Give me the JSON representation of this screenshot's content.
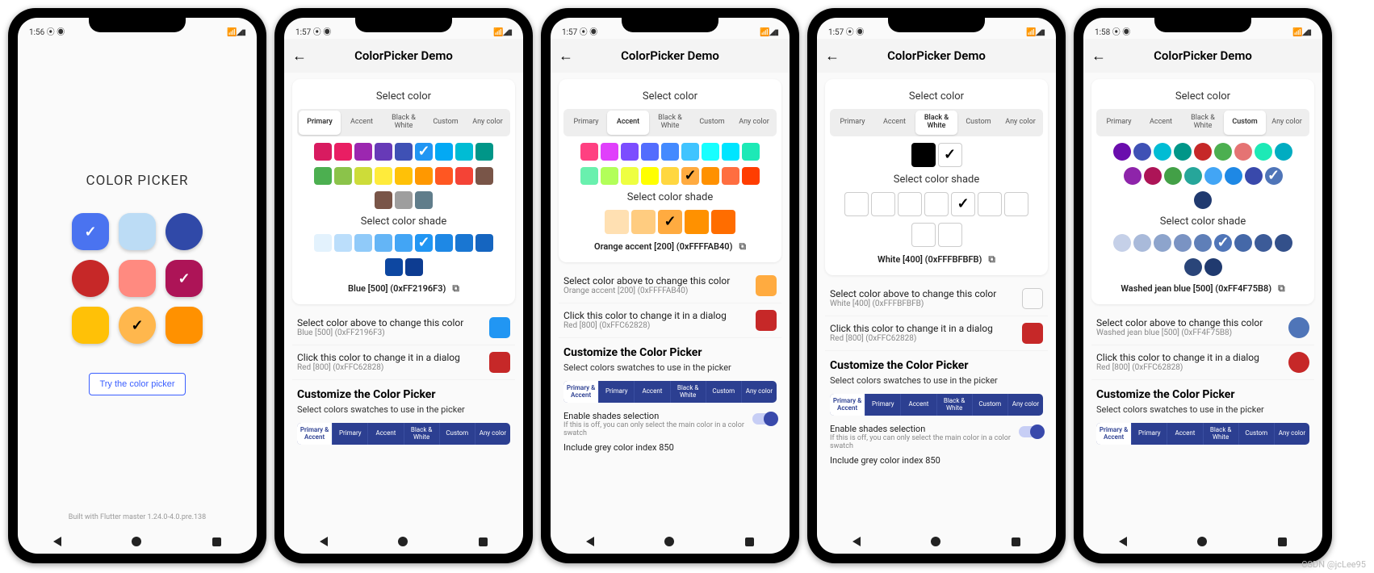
{
  "phones": [
    {
      "time": "1:56",
      "home": {
        "title": "COLOR PICKER",
        "swatches": [
          {
            "color": "#4a73f0",
            "shape": "sq",
            "check": "white"
          },
          {
            "color": "#bcdcf5",
            "shape": "sq"
          },
          {
            "color": "#3049a8",
            "shape": "circle"
          },
          {
            "color": "#c62828",
            "shape": "circle"
          },
          {
            "color": "#ff8a80",
            "shape": "sq"
          },
          {
            "color": "#ad1457",
            "shape": "sq",
            "check": "white"
          },
          {
            "color": "#ffc107",
            "shape": "sq"
          },
          {
            "color": "#ffb74d",
            "shape": "circle",
            "check": "dark"
          },
          {
            "color": "#ff9100",
            "shape": "sq"
          }
        ],
        "button": "Try the color picker",
        "footer": "Built with Flutter master 1.24.0-4.0.pre.138"
      }
    },
    {
      "time": "1:57",
      "appbar_title": "ColorPicker Demo",
      "select_color_title": "Select color",
      "tabs": [
        "Primary",
        "Accent",
        "Black & White",
        "Custom",
        "Any color"
      ],
      "active_tab": 0,
      "main_swatches": [
        [
          "#d81b60",
          "#e91e63",
          "#9c27b0",
          "#673ab7",
          "#3f51b5",
          "#2196f3",
          "#03a9f4",
          "#00bcd4",
          "#009688"
        ],
        [
          "#4caf50",
          "#8bc34a",
          "#cddc39",
          "#ffeb3b",
          "#ffc107",
          "#ff9800",
          "#ff5722",
          "#f44336",
          "#795548"
        ],
        [
          "#795548",
          "#9e9e9e",
          "#607d8b"
        ]
      ],
      "main_checked": {
        "row": 0,
        "col": 5,
        "tone": "white"
      },
      "shade_title": "Select color shade",
      "shade_swatches": [
        [
          "#e3f2fd",
          "#bbdefb",
          "#90caf9",
          "#64b5f6",
          "#42a5f5",
          "#2196f3",
          "#1e88e5",
          "#1976d2",
          "#1565c0"
        ],
        [
          "#0d47a1",
          "#0d3c91"
        ]
      ],
      "shade_checked": {
        "row": 0,
        "col": 5,
        "tone": "white"
      },
      "result": "Blue [500] (0xFF2196F3)",
      "row_above": {
        "t1": "Select color above to change this color",
        "t2": "Blue [500] (0xFF2196F3)",
        "color": "#2196f3"
      },
      "row_dialog": {
        "t1": "Click this color to change it in a dialog",
        "t2": "Red [800] (0xFFC62828)",
        "color": "#c62828"
      },
      "customize_h": "Customize the Color Picker",
      "customize_sub": "Select colors swatches to use in the picker",
      "seg": [
        "Primary & Accent",
        "Primary",
        "Accent",
        "Black & White",
        "Custom",
        "Any color"
      ],
      "seg_active": 0
    },
    {
      "time": "1:57",
      "appbar_title": "ColorPicker Demo",
      "select_color_title": "Select color",
      "tabs": [
        "Primary",
        "Accent",
        "Black & White",
        "Custom",
        "Any color"
      ],
      "active_tab": 1,
      "main_swatches": [
        [
          "#ff4081",
          "#e040fb",
          "#7c4dff",
          "#536dfe",
          "#448aff",
          "#40c4ff",
          "#18ffff",
          "#00e5ff",
          "#1de9b6"
        ],
        [
          "#69f0ae",
          "#b2ff59",
          "#eeff41",
          "#ffff00",
          "#ffd740",
          "#ffab40",
          "#ff9100",
          "#ff6e40",
          "#ff3d00"
        ]
      ],
      "main_checked": {
        "row": 1,
        "col": 5,
        "tone": "dark"
      },
      "shade_title": "Select color shade",
      "shade_swatches": [
        [
          "#ffe0b2",
          "#ffcc80",
          "#ffab40",
          "#ff9100",
          "#ff6d00"
        ]
      ],
      "shade_bigger": true,
      "shade_checked": {
        "row": 0,
        "col": 2,
        "tone": "dark"
      },
      "result": "Orange accent [200] (0xFFFFAB40)",
      "row_above": {
        "t1": "Select color above to change this color",
        "t2": "Orange accent [200] (0xFFFFAB40)",
        "color": "#ffab40"
      },
      "row_dialog": {
        "t1": "Click this color to change it in a dialog",
        "t2": "Red [800] (0xFFC62828)",
        "color": "#c62828"
      },
      "customize_h": "Customize the Color Picker",
      "customize_sub": "Select colors swatches to use in the picker",
      "seg": [
        "Primary & Accent",
        "Primary",
        "Accent",
        "Black & White",
        "Custom",
        "Any color"
      ],
      "seg_active": 0,
      "toggle1": {
        "t1": "Enable shades selection",
        "t2": "If this is off, you can only select the main color in a color swatch"
      },
      "extra_line": "Include grey color index 850"
    },
    {
      "time": "1:57",
      "appbar_title": "ColorPicker Demo",
      "select_color_title": "Select color",
      "tabs": [
        "Primary",
        "Accent",
        "Black & White",
        "Custom",
        "Any color"
      ],
      "active_tab": 2,
      "bw_swatches": [
        {
          "color": "#000000"
        },
        {
          "color": "#ffffff",
          "check": "dark",
          "border": true
        }
      ],
      "shade_title": "Select color shade",
      "bw_shades": [
        [
          {
            "c": "#ffffff"
          },
          {
            "c": "#ffffff"
          },
          {
            "c": "#ffffff"
          },
          {
            "c": "#ffffff"
          },
          {
            "c": "#ffffff",
            "check": "dark"
          },
          {
            "c": "#ffffff"
          },
          {
            "c": "#ffffff"
          }
        ],
        [
          {
            "c": "#ffffff"
          },
          {
            "c": "#ffffff"
          }
        ]
      ],
      "result": "White [400] (0xFFFBFBFB)",
      "row_above": {
        "t1": "Select color above to change this color",
        "t2": "White [400] (0xFFFBFBFB)",
        "color": "#fbfbfb",
        "border": true
      },
      "row_dialog": {
        "t1": "Click this color to change it in a dialog",
        "t2": "Red [800] (0xFFC62828)",
        "color": "#c62828"
      },
      "customize_h": "Customize the Color Picker",
      "customize_sub": "Select colors swatches to use in the picker",
      "seg": [
        "Primary & Accent",
        "Primary",
        "Accent",
        "Black & White",
        "Custom",
        "Any color"
      ],
      "seg_active": 0,
      "toggle1": {
        "t1": "Enable shades selection",
        "t2": "If this is off, you can only select the main color in a color swatch"
      },
      "extra_line": "Include grey color index 850"
    },
    {
      "time": "1:58",
      "appbar_title": "ColorPicker Demo",
      "select_color_title": "Select color",
      "tabs": [
        "Primary",
        "Accent",
        "Black & White",
        "Custom",
        "Any color"
      ],
      "active_tab": 3,
      "custom_swatches": [
        [
          "#6a0dad",
          "#3f51b5",
          "#00bcd4",
          "#009688",
          "#c62828",
          "#4caf50",
          "#e57373",
          "#1de9b6",
          "#00acc1"
        ],
        [
          "#8e24aa",
          "#ad1457",
          "#43a047",
          "#26a69a",
          "#42a5f5",
          "#1e88e5",
          "#3949ab",
          "#4f75b8"
        ],
        [
          "#203a6f"
        ]
      ],
      "custom_round": true,
      "main_checked": {
        "row": 1,
        "col": 7,
        "tone": "white"
      },
      "shade_title": "Select color shade",
      "custom_shades": [
        [
          "#c5d0e8",
          "#a9bada",
          "#8da4cc",
          "#7a93c3",
          "#5f7fb8",
          "#4f75b8",
          "#4568a8",
          "#3c5b98",
          "#33508a"
        ],
        [
          "#2a4579",
          "#203a6f"
        ]
      ],
      "shade_checked": {
        "row": 0,
        "col": 5,
        "tone": "white"
      },
      "result": "Washed jean blue [500] (0xFF4F75B8)",
      "row_above": {
        "t1": "Select color above to change this color",
        "t2": "Washed jean blue [500] (0xFF4F75B8)",
        "color": "#4f75b8",
        "round": true
      },
      "row_dialog": {
        "t1": "Click this color to change it in a dialog",
        "t2": "Red [800] (0xFFC62828)",
        "color": "#c62828",
        "round": true
      },
      "customize_h": "Customize the Color Picker",
      "customize_sub": "Select colors swatches to use in the picker",
      "seg": [
        "Primary & Accent",
        "Primary",
        "Accent",
        "Black & White",
        "Custom",
        "Any color"
      ],
      "seg_active": 0
    }
  ],
  "watermark": "CSDN @jcLee95"
}
